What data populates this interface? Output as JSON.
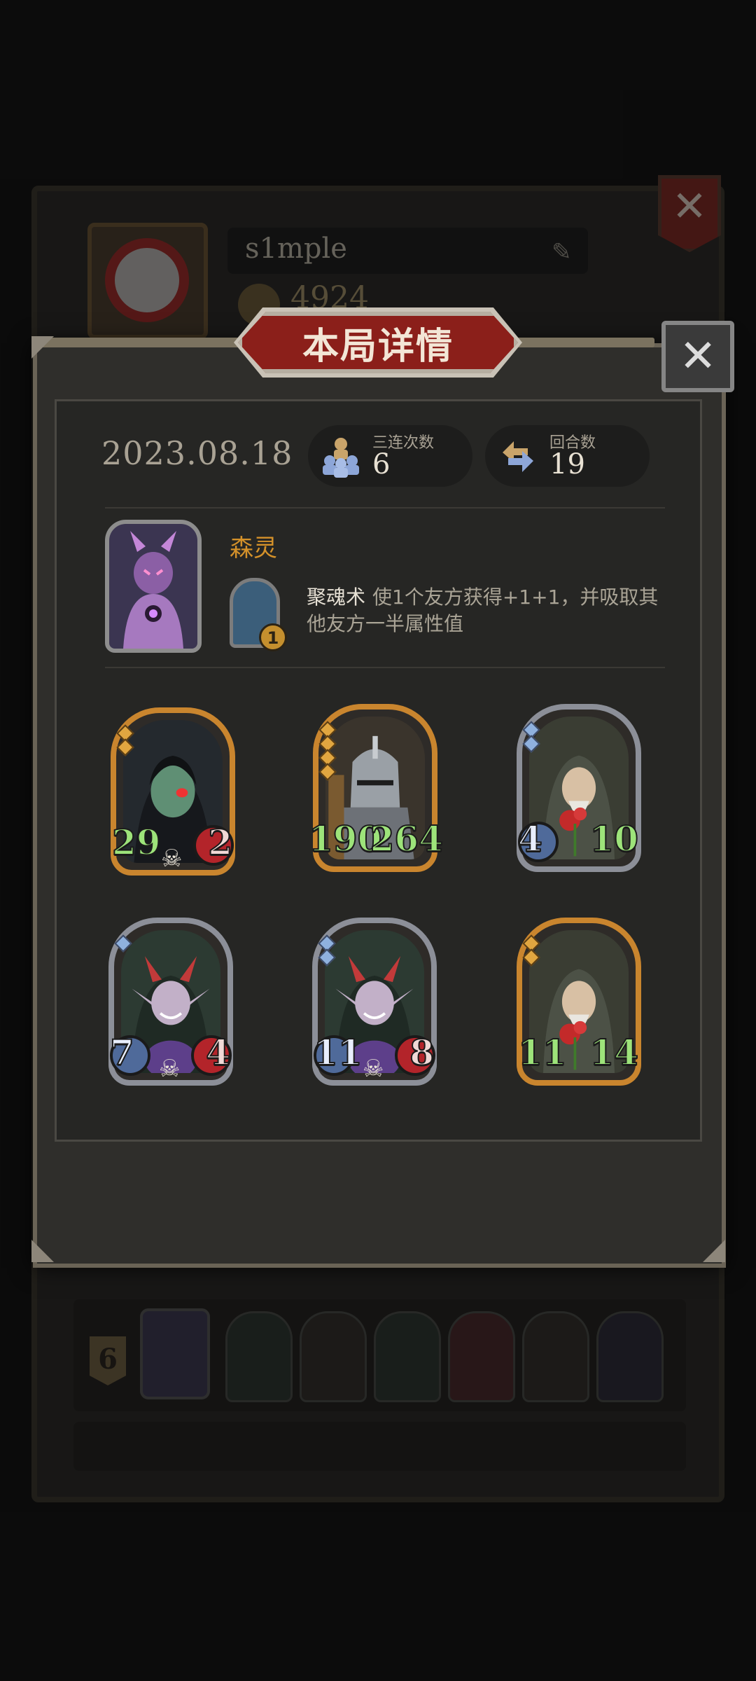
{
  "profile": {
    "name": "s1mple",
    "coins": "4924",
    "rank_badge": "6"
  },
  "modal": {
    "title": "本局详情",
    "close_symbol": "✕"
  },
  "summary": {
    "date": "2023.08.18",
    "triples_label": "三连次数",
    "triples_value": "6",
    "rounds_label": "回合数",
    "rounds_value": "19"
  },
  "hero": {
    "name": "森灵",
    "skill_level": "1",
    "skill_name": "聚魂术",
    "skill_desc": "使1个友方获得+1+1，并吸取其他友方一半属性值"
  },
  "units": [
    {
      "attack": "29",
      "health": "2",
      "frame": "gold",
      "stars": 2,
      "portrait": "hooded-ghost",
      "skull": true,
      "health_style": "red"
    },
    {
      "attack": "190",
      "health": "264",
      "frame": "gold",
      "stars": 4,
      "portrait": "armored-knight",
      "skull": false,
      "health_style": "green"
    },
    {
      "attack": "4",
      "health": "10",
      "frame": "silver",
      "stars": 2,
      "portrait": "rose-monk",
      "skull": false,
      "health_style": "green"
    },
    {
      "attack": "7",
      "health": "4",
      "frame": "silver",
      "stars": 1,
      "portrait": "horned-elf",
      "skull": true,
      "health_style": "red"
    },
    {
      "attack": "11",
      "health": "8",
      "frame": "silver",
      "stars": 2,
      "portrait": "horned-elf",
      "skull": true,
      "health_style": "red"
    },
    {
      "attack": "11",
      "health": "14",
      "frame": "gold",
      "stars": 2,
      "portrait": "rose-monk",
      "skull": false,
      "health_style": "green"
    }
  ],
  "colors": {
    "gold_frame": "#c9852e",
    "silver_frame": "#8c8f98",
    "attack_green": "#9de37a",
    "title_red": "#8b1f1a",
    "hero_name": "#d4912a"
  }
}
